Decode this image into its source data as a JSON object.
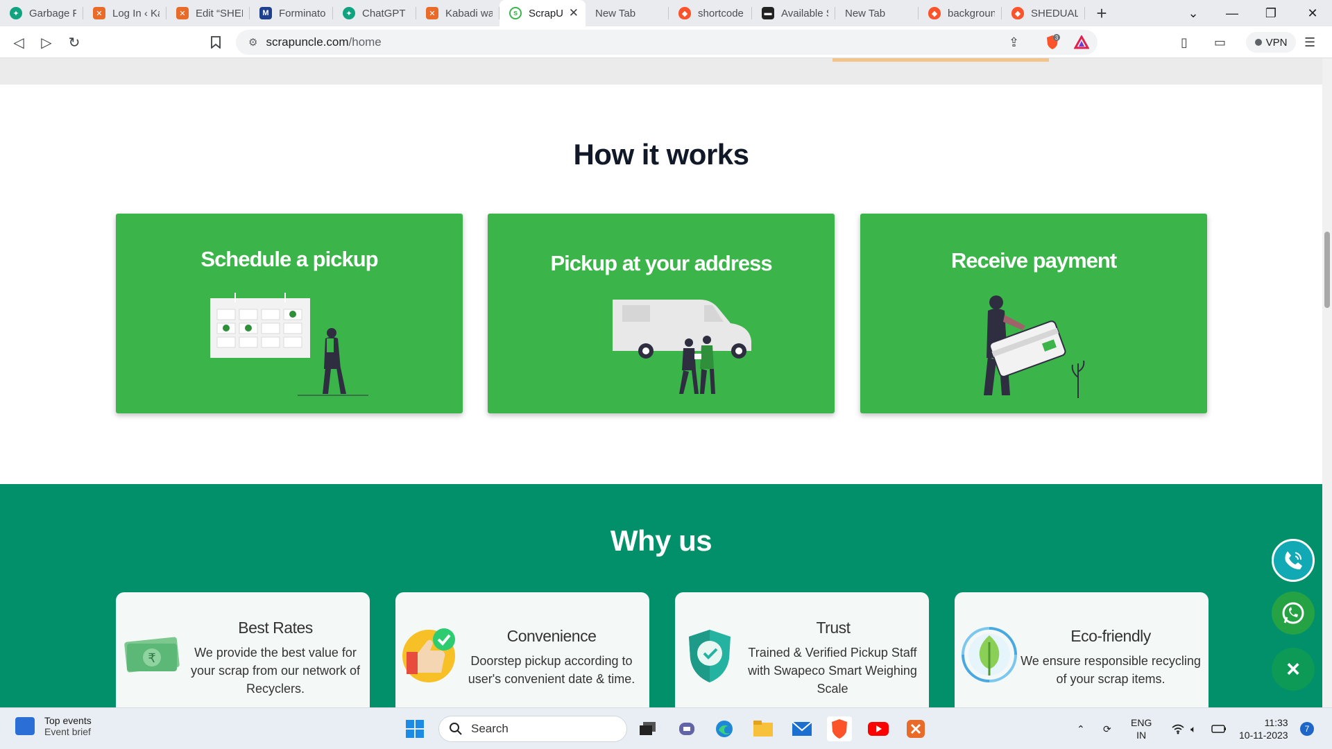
{
  "browser": {
    "tabs": [
      {
        "title": "Garbage Pi",
        "favicon": "chatgpt-icon",
        "color": "#10a37f"
      },
      {
        "title": "Log In ‹ Kab",
        "favicon": "xampp-icon",
        "color": "#e86b2a"
      },
      {
        "title": "Edit “SHED",
        "favicon": "xampp-icon",
        "color": "#e86b2a"
      },
      {
        "title": "Forminator",
        "favicon": "forminator-icon",
        "color": "#1f3f8f"
      },
      {
        "title": "ChatGPT",
        "favicon": "chatgpt-icon",
        "color": "#10a37f"
      },
      {
        "title": "Kabadi wal",
        "favicon": "xampp-icon",
        "color": "#e86b2a"
      },
      {
        "title": "ScrapU",
        "favicon": "scrapuncle-icon",
        "color": "#3bb54a",
        "active": true
      },
      {
        "title": "New Tab",
        "favicon": "none"
      },
      {
        "title": "shortcode",
        "favicon": "brave-icon",
        "color": "#fb542b"
      },
      {
        "title": "Available S",
        "favicon": "terminal-icon",
        "color": "#222222"
      },
      {
        "title": "New Tab",
        "favicon": "none"
      },
      {
        "title": "backgroun",
        "favicon": "brave-icon",
        "color": "#fb542b"
      },
      {
        "title": "SHEDUALE",
        "favicon": "brave-icon",
        "color": "#fb542b"
      }
    ],
    "url_host": "scrapuncle.com",
    "url_path": "/home",
    "vpn_label": "VPN",
    "shield_count": "3"
  },
  "how_it_works": {
    "title": "How it works",
    "steps": [
      {
        "title": "Schedule a pickup",
        "illustration": "calendar-person-illustration"
      },
      {
        "title": "Pickup at your address",
        "illustration": "van-people-illustration"
      },
      {
        "title": "Receive payment",
        "illustration": "person-card-illustration"
      }
    ]
  },
  "why_us": {
    "title": "Why us",
    "items": [
      {
        "title": "Best Rates",
        "text": "We provide the best value for your scrap from our network of Recyclers.",
        "icon": "rupee-note-icon"
      },
      {
        "title": "Convenience",
        "text": "Doorstep pickup according to user's convenient date & time.",
        "icon": "thumbs-up-check-icon"
      },
      {
        "title": "Trust",
        "text": "Trained & Verified Pickup Staff with Swapeco Smart Weighing Scale",
        "icon": "shield-check-icon"
      },
      {
        "title": "Eco-friendly",
        "text": "We ensure responsible recycling of your scrap items.",
        "icon": "leaf-recycle-icon"
      }
    ]
  },
  "floating_buttons": {
    "call_icon": "phone-icon",
    "whatsapp_icon": "whatsapp-icon",
    "close_label": "×"
  },
  "taskbar": {
    "widget_title": "Top events",
    "widget_subtitle": "Event brief",
    "search_placeholder": "Search",
    "lang_line1": "ENG",
    "lang_line2": "IN",
    "time": "11:33",
    "date": "10-11-2023",
    "notification_count": "7"
  },
  "colors": {
    "step_card": "#3bb54a",
    "why_bg": "#02906a",
    "whatsapp": "#25a244",
    "call": "#10a9b4"
  }
}
